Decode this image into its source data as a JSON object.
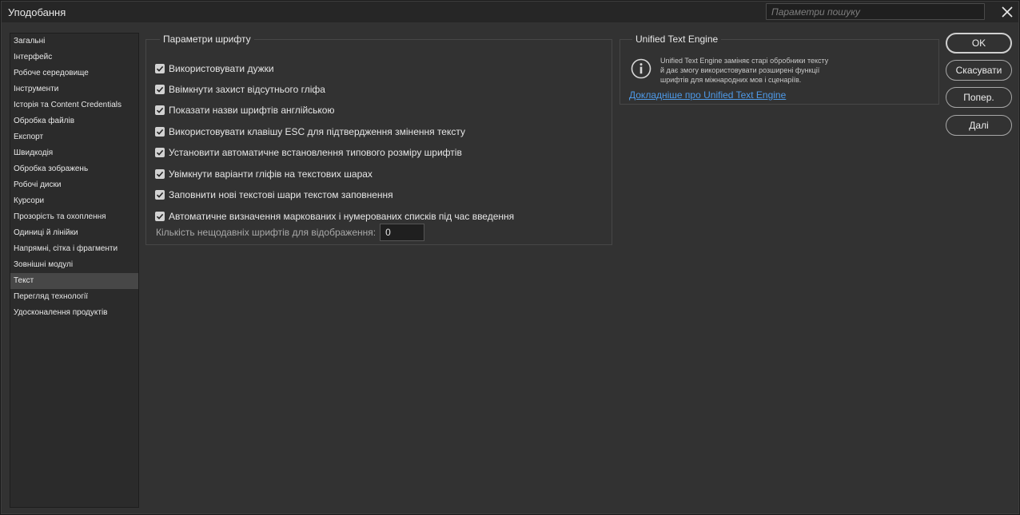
{
  "window": {
    "title": "Уподобання"
  },
  "search": {
    "placeholder": "Параметри пошуку"
  },
  "icons": {
    "close": "close-icon",
    "info": "info-icon",
    "check": "checkmark-icon"
  },
  "colors": {
    "link": "#4e9ae8",
    "active_item": "#474747",
    "checkbox": "#d2d2d2"
  },
  "sidebar": {
    "active_index": 15,
    "items": [
      {
        "label": "Загальні"
      },
      {
        "label": "Інтерфейс"
      },
      {
        "label": "Робоче середовище"
      },
      {
        "label": "Інструменти"
      },
      {
        "label": "Історія та Content Credentials"
      },
      {
        "label": "Обробка файлів"
      },
      {
        "label": "Експорт"
      },
      {
        "label": "Швидкодія"
      },
      {
        "label": "Обробка зображень"
      },
      {
        "label": "Робочі диски"
      },
      {
        "label": "Курсори"
      },
      {
        "label": "Прозорість та охоплення"
      },
      {
        "label": "Одиниці й лінійки"
      },
      {
        "label": "Напрямні, сітка і фрагменти"
      },
      {
        "label": "Зовнішні модулі"
      },
      {
        "label": "Текст"
      },
      {
        "label": "Перегляд технології"
      },
      {
        "label": "Удосконалення продуктів"
      }
    ]
  },
  "font_options": {
    "title": "Параметри шрифту",
    "checkboxes": [
      {
        "label": "Використовувати дужки",
        "checked": true
      },
      {
        "label": "Ввімкнути захист відсутнього гліфа",
        "checked": true
      },
      {
        "label": "Показати назви шрифтів англійською",
        "checked": true
      },
      {
        "label": "Використовувати клавішу ESC для підтвердження змінення тексту",
        "checked": true
      },
      {
        "label": "Установити автоматичне встановлення типового розміру шрифтів",
        "checked": true
      },
      {
        "label": "Увімкнути варіанти гліфів на текстових шарах",
        "checked": true
      },
      {
        "label": "Заповнити нові текстові шари текстом заповнення",
        "checked": true
      },
      {
        "label": "Автоматичне визначення маркованих і нумерованих списків під час введення",
        "checked": true
      }
    ],
    "recent_fonts": {
      "label": "Кількість нещодавніх шрифтів для відображення:",
      "value": "0"
    }
  },
  "unified_text_engine": {
    "title": "Unified Text Engine",
    "description_lines": [
      "Unified Text Engine заміняє старі обробники тексту",
      "й дає змогу використовувати розширені функції",
      "шрифтів для міжнародних мов і сценаріїв."
    ],
    "link": "Докладніше про Unified Text Engine"
  },
  "buttons": {
    "ok": "OK",
    "cancel": "Скасувати",
    "prev": "Попер.",
    "next": "Далі"
  }
}
